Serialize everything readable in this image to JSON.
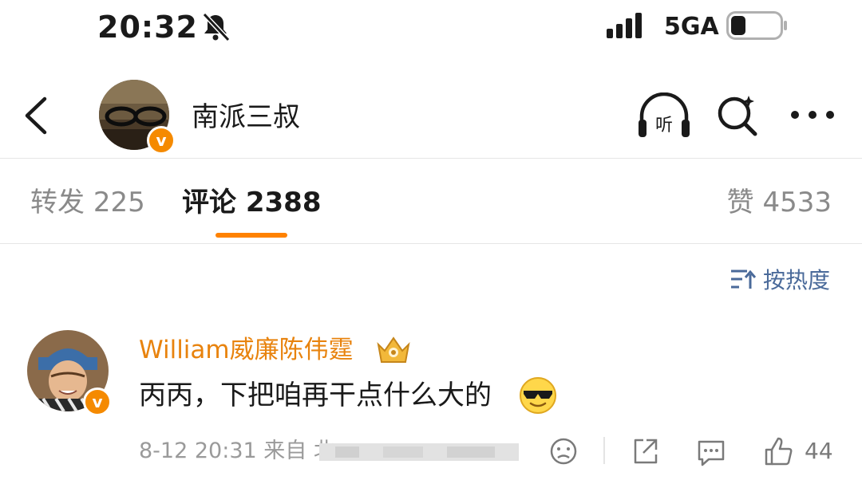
{
  "status_bar": {
    "time": "20:32",
    "network": "5GA"
  },
  "header": {
    "title": "南派三叔"
  },
  "tabs": [
    {
      "label": "转发",
      "count": "225"
    },
    {
      "label": "评论",
      "count": "2388"
    },
    {
      "label": "赞",
      "count": "4533"
    }
  ],
  "sort": {
    "label": "按热度"
  },
  "comment": {
    "username": "William威廉陈伟霆",
    "text": "丙丙，下把咱再干点什么大的",
    "meta": "8-12 20:31 来自 北",
    "likes": "44"
  },
  "colors": {
    "accent": "#ff8200",
    "username": "#e8830e",
    "link": "#4a6a9a"
  }
}
